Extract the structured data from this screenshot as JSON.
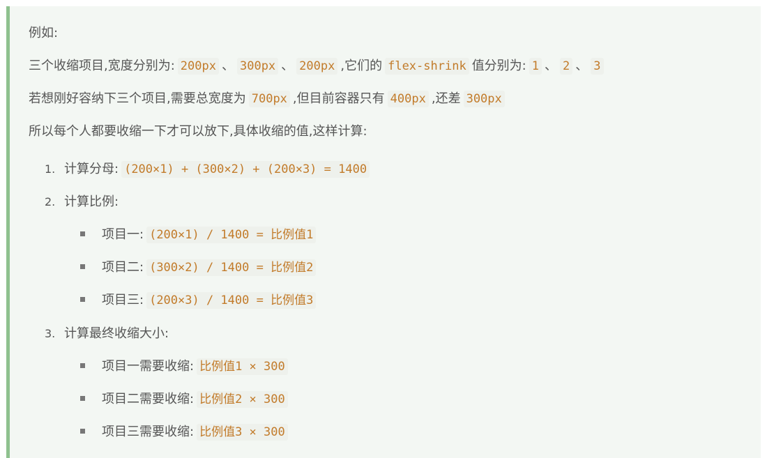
{
  "intro": {
    "label": "例如:"
  },
  "line2": {
    "p1": "三个收缩项目,宽度分别为:",
    "c1": "200px",
    "sep1": "、",
    "c2": "300px",
    "sep2": "、",
    "c3": "200px",
    "p2": ",它们的",
    "c4": "flex-shrink",
    "p3": "值分别为:",
    "c5": "1",
    "sep3": "、",
    "c6": "2",
    "sep4": "、",
    "c7": "3"
  },
  "line3": {
    "p1": "若想刚好容纳下三个项目,需要总宽度为",
    "c1": "700px",
    "p2": ",但目前容器只有",
    "c2": "400px",
    "p3": ",还差",
    "c3": "300px"
  },
  "line4": {
    "text": "所以每个人都要收缩一下才可以放下,具体收缩的值,这样计算:"
  },
  "steps": [
    {
      "num": "1.",
      "label": "计算分母:",
      "code": "(200×1) + (300×2) + (200×3) = 1400"
    },
    {
      "num": "2.",
      "label": "计算比例:",
      "items": [
        {
          "label": "项目一:",
          "code": "(200×1) / 1400 = 比例值1"
        },
        {
          "label": "项目二:",
          "code": "(300×2) / 1400 = 比例值2"
        },
        {
          "label": "项目三:",
          "code": "(200×3) / 1400 = 比例值3"
        }
      ]
    },
    {
      "num": "3.",
      "label": "计算最终收缩大小:",
      "items": [
        {
          "label": "项目一需要收缩:",
          "code": "比例值1 × 300"
        },
        {
          "label": "项目二需要收缩:",
          "code": "比例值2 × 300"
        },
        {
          "label": "项目三需要收缩:",
          "code": "比例值3 × 300"
        }
      ]
    }
  ]
}
